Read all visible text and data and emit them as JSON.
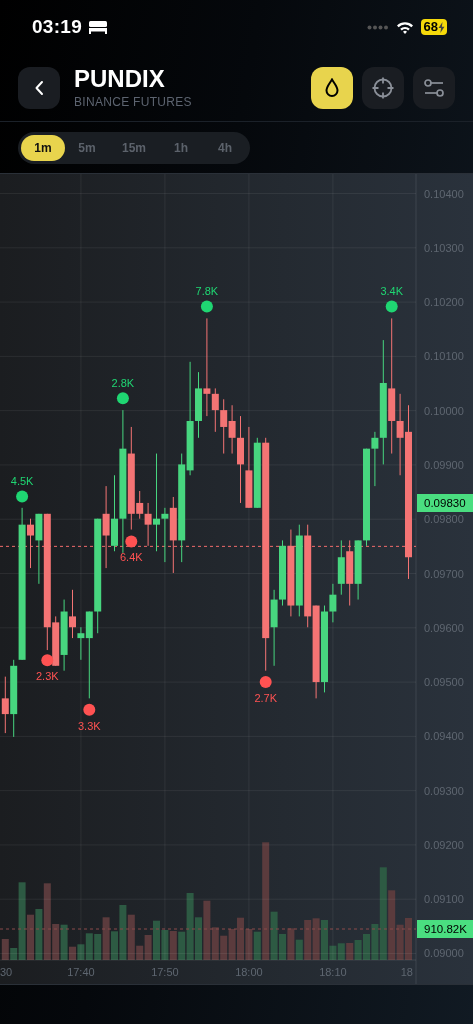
{
  "status_bar": {
    "time": "03:19",
    "battery": "68"
  },
  "header": {
    "title": "PUNDIX",
    "subtitle": "BINANCE FUTURES",
    "actions": [
      {
        "kind": "drop",
        "selected": true
      },
      {
        "kind": "crosshair",
        "selected": false
      },
      {
        "kind": "sliders",
        "selected": false
      }
    ]
  },
  "timeframes": [
    {
      "label": "1m",
      "selected": true
    },
    {
      "label": "5m",
      "selected": false
    },
    {
      "label": "15m",
      "selected": false
    },
    {
      "label": "1h",
      "selected": false
    },
    {
      "label": "4h",
      "selected": false
    }
  ],
  "chart": {
    "chart_data": {
      "type": "candlestick",
      "grid": true,
      "categories": [
        null,
        null,
        null,
        null,
        null,
        null,
        null,
        null,
        null,
        "17:40",
        null,
        null,
        null,
        null,
        null,
        null,
        null,
        null,
        null,
        "17:50",
        null,
        null,
        null,
        null,
        null,
        null,
        null,
        null,
        null,
        "18:00",
        null,
        null,
        null,
        null,
        null,
        null,
        null,
        null,
        null,
        "18:10",
        null,
        null,
        null,
        null,
        null,
        null,
        null,
        null,
        null
      ],
      "ylim": [
        0.08988,
        0.10436
      ],
      "yticks": [
        {
          "value": 0.104,
          "label": "0.10400"
        },
        {
          "value": 0.103,
          "label": "0.10300"
        },
        {
          "value": 0.102,
          "label": "0.10200"
        },
        {
          "value": 0.101,
          "label": "0.10100"
        },
        {
          "value": 0.1,
          "label": "0.10000"
        },
        {
          "value": 0.099,
          "label": "0.09900"
        },
        {
          "value": 0.098,
          "label": "0.09800"
        },
        {
          "value": 0.097,
          "label": "0.09700"
        },
        {
          "value": 0.096,
          "label": "0.09600"
        },
        {
          "value": 0.095,
          "label": "0.09500"
        },
        {
          "value": 0.094,
          "label": "0.09400"
        },
        {
          "value": 0.093,
          "label": "0.09300"
        },
        {
          "value": 0.092,
          "label": "0.09200"
        },
        {
          "value": 0.091,
          "label": "0.09100"
        },
        {
          "value": 0.09,
          "label": "0.09000"
        }
      ],
      "ohlc": [
        [
          0.0947,
          0.0951,
          0.09406,
          0.09441
        ],
        [
          0.09441,
          0.09541,
          0.09399,
          0.0953
        ],
        [
          0.09541,
          0.09821,
          0.09541,
          0.0979
        ],
        [
          0.0979,
          0.09801,
          0.0971,
          0.0977
        ],
        [
          0.09761,
          0.0981,
          0.09681,
          0.0981
        ],
        [
          0.0981,
          0.0981,
          0.09559,
          0.09601
        ],
        [
          0.0961,
          0.09621,
          0.0953,
          0.0953
        ],
        [
          0.0955,
          0.09652,
          0.09521,
          0.0963
        ],
        [
          0.09621,
          0.0967,
          0.09581,
          0.09601
        ],
        [
          0.09581,
          0.09601,
          0.09541,
          0.0959
        ],
        [
          0.09581,
          0.0963,
          0.0947,
          0.0963
        ],
        [
          0.0963,
          0.09801,
          0.0959,
          0.09801
        ],
        [
          0.0981,
          0.09861,
          0.0971,
          0.0977
        ],
        [
          0.09751,
          0.09881,
          0.09741,
          0.09801
        ],
        [
          0.09801,
          0.10001,
          0.09738,
          0.0993
        ],
        [
          0.09921,
          0.0997,
          0.09781,
          0.0981
        ],
        [
          0.0983,
          0.09852,
          0.09801,
          0.0981
        ],
        [
          0.0981,
          0.0983,
          0.09751,
          0.0979
        ],
        [
          0.0979,
          0.09921,
          0.09741,
          0.09801
        ],
        [
          0.09801,
          0.09821,
          0.09721,
          0.0981
        ],
        [
          0.09821,
          0.09841,
          0.09701,
          0.09761
        ],
        [
          0.09761,
          0.09921,
          0.09721,
          0.09901
        ],
        [
          0.0989,
          0.1009,
          0.09881,
          0.09981
        ],
        [
          0.09981,
          0.10071,
          0.0995,
          0.10041
        ],
        [
          0.10041,
          0.1017,
          0.0999,
          0.10031
        ],
        [
          0.10031,
          0.10041,
          0.09961,
          0.10001
        ],
        [
          0.10001,
          0.10021,
          0.09921,
          0.0997
        ],
        [
          0.09981,
          0.1001,
          0.09921,
          0.0995
        ],
        [
          0.0995,
          0.0999,
          0.0983,
          0.09901
        ],
        [
          0.0989,
          0.0997,
          0.09821,
          0.09821
        ],
        [
          0.09821,
          0.0995,
          0.09821,
          0.09941
        ],
        [
          0.09941,
          0.0995,
          0.09521,
          0.09581
        ],
        [
          0.09601,
          0.0967,
          0.0953,
          0.09652
        ],
        [
          0.09652,
          0.09761,
          0.09641,
          0.09751
        ],
        [
          0.09751,
          0.09781,
          0.09621,
          0.09641
        ],
        [
          0.09641,
          0.0979,
          0.09621,
          0.0977
        ],
        [
          0.0977,
          0.0979,
          0.09601,
          0.09621
        ],
        [
          0.09641,
          0.09641,
          0.0947,
          0.095
        ],
        [
          0.095,
          0.09641,
          0.09481,
          0.0963
        ],
        [
          0.0963,
          0.09681,
          0.0961,
          0.09661
        ],
        [
          0.09681,
          0.09761,
          0.09661,
          0.0973
        ],
        [
          0.09741,
          0.09761,
          0.09641,
          0.09681
        ],
        [
          0.09681,
          0.09761,
          0.09652,
          0.09761
        ],
        [
          0.09761,
          0.0993,
          0.09751,
          0.0993
        ],
        [
          0.0993,
          0.09961,
          0.09861,
          0.0995
        ],
        [
          0.0995,
          0.1013,
          0.09901,
          0.10051
        ],
        [
          0.10041,
          0.1017,
          0.09921,
          0.09981
        ],
        [
          0.09981,
          0.10031,
          0.09881,
          0.0995
        ],
        [
          0.09961,
          0.1001,
          0.0969,
          0.0973
        ]
      ],
      "ref_lines": [
        {
          "axis": "y",
          "value": 0.0975,
          "color": "#f06b6b"
        }
      ]
    },
    "cut_time_labels": [
      "30",
      "18"
    ],
    "price_tag": "0.09830",
    "markers": [
      {
        "text": "4.5K",
        "color": "#1fd672"
      },
      {
        "text": "2.3K",
        "color": "#ff5252"
      },
      {
        "text": "3.3K",
        "color": "#ff5252"
      },
      {
        "text": "2.8K",
        "color": "#1fd672"
      },
      {
        "text": "6.4K",
        "color": "#ff5252"
      },
      {
        "text": "7.8K",
        "color": "#1fd672"
      },
      {
        "text": "2.7K",
        "color": "#ff5252"
      },
      {
        "text": "3.4K",
        "color": "#1fd672"
      }
    ],
    "volume": {
      "volume_tag": "910.82K"
    }
  }
}
